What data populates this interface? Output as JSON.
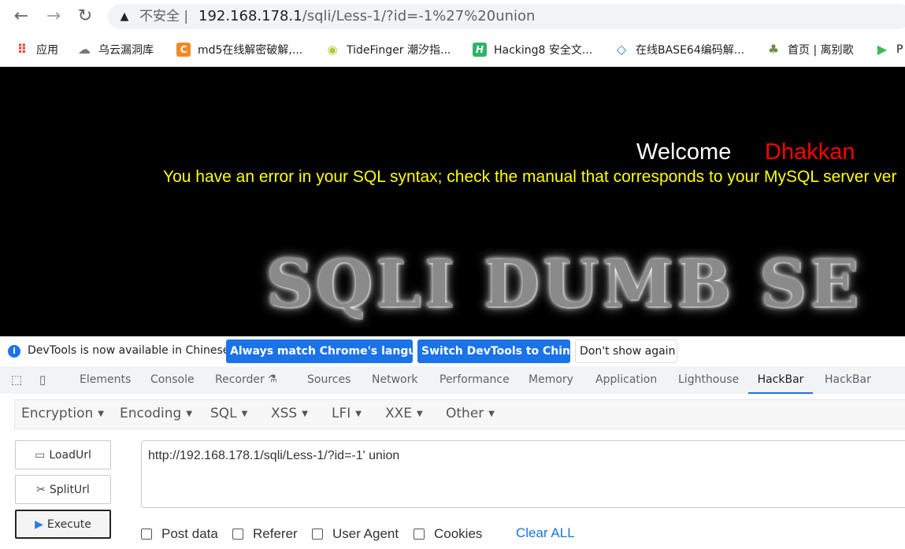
{
  "browser": {
    "back_icon": "←",
    "forward_icon": "→",
    "reload_icon": "↻",
    "security_label": "不安全 |",
    "url_host": "192.168.178.1",
    "url_path": "/sqli/Less-1/?id=-1%27%20union"
  },
  "bookmarks": [
    {
      "label": "应用",
      "icon": "apps-grid-icon"
    },
    {
      "label": "乌云漏洞库",
      "icon": "wooyun-icon"
    },
    {
      "label": "md5在线解密破解,...",
      "icon": "cmd5-icon"
    },
    {
      "label": "TideFinger 潮汐指...",
      "icon": "fingerprint-icon"
    },
    {
      "label": "Hacking8 安全文...",
      "icon": "hacking8-icon"
    },
    {
      "label": "在线BASE64编码解...",
      "icon": "base64-icon"
    },
    {
      "label": "首页 | 离别歌",
      "icon": "leavesongs-icon"
    },
    {
      "label": "P",
      "icon": "bookmark-icon"
    }
  ],
  "page": {
    "welcome": "Welcome",
    "username": "Dhakkan",
    "error": "You have an error in your SQL syntax; check the manual that corresponds to your MySQL server ver",
    "banner": "SQLI DUMB SE"
  },
  "infobar": {
    "message": "DevTools is now available in Chinese!",
    "btn_match": "Always match Chrome's language",
    "btn_switch": "Switch DevTools to Chinese",
    "btn_dismiss": "Don't show again"
  },
  "devtools": {
    "tabs": [
      "Elements",
      "Console",
      "Recorder",
      "Sources",
      "Network",
      "Performance",
      "Memory",
      "Application",
      "Lighthouse",
      "HackBar",
      "HackBar"
    ],
    "active_tab": "HackBar"
  },
  "hackbar": {
    "menus": [
      "Encryption",
      "Encoding",
      "SQL",
      "XSS",
      "LFI",
      "XXE",
      "Other"
    ],
    "buttons": {
      "load": "LoadUrl",
      "split": "SplitUrl",
      "execute": "Execute"
    },
    "url_value": "http://192.168.178.1/sqli/Less-1/?id=-1' union",
    "options": [
      "Post data",
      "Referer",
      "User Agent",
      "Cookies"
    ],
    "clear_all": "Clear ALL"
  },
  "colors": {
    "accent": "#1a73e8",
    "page_bg": "#000000",
    "username": "#ff0000",
    "error_text": "#ffff00"
  }
}
